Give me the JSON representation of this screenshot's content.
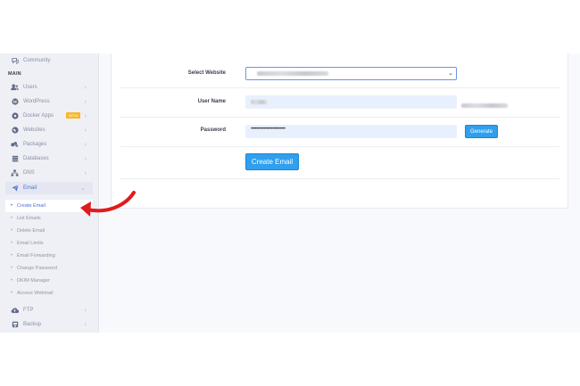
{
  "sidebar": {
    "community": "Community",
    "section_main": "MAIN",
    "items": [
      {
        "label": "Users",
        "icon": "users-icon"
      },
      {
        "label": "WordPress",
        "icon": "wordpress-icon"
      },
      {
        "label": "Docker Apps",
        "icon": "docker-icon",
        "badge": "BETA"
      },
      {
        "label": "Websites",
        "icon": "globe-icon"
      },
      {
        "label": "Packages",
        "icon": "packages-icon"
      },
      {
        "label": "Databases",
        "icon": "database-icon"
      },
      {
        "label": "DNS",
        "icon": "dns-icon"
      },
      {
        "label": "Email",
        "icon": "paper-plane-icon"
      }
    ],
    "email_sub": [
      "Create Email",
      "List Emails",
      "Delete Email",
      "Email Limits",
      "Email Forwarding",
      "Change Password",
      "DKIM Manager",
      "Access Webmail"
    ],
    "after": [
      {
        "label": "FTP",
        "icon": "cloud-upload-icon"
      },
      {
        "label": "Backup",
        "icon": "backup-icon"
      }
    ]
  },
  "form": {
    "select_website_label": "Select Website",
    "user_name_label": "User Name",
    "password_label": "Password",
    "password_value": "••••••••••••••••••••••••",
    "generate_label": "Generate",
    "create_label": "Create Email"
  },
  "colors": {
    "accent": "#2f9fee",
    "arrow": "#e01b1b",
    "badge": "#f7b924"
  }
}
